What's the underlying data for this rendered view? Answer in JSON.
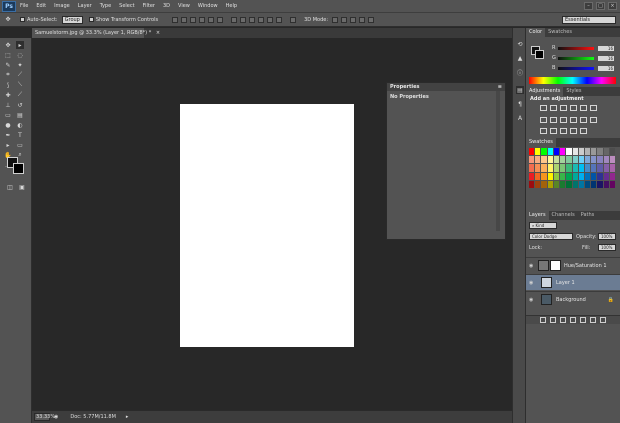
{
  "menubar": {
    "logo": "Ps",
    "items": [
      "File",
      "Edit",
      "Image",
      "Layer",
      "Type",
      "Select",
      "Filter",
      "3D",
      "View",
      "Window",
      "Help"
    ],
    "window_controls": [
      "–",
      "□",
      "×"
    ]
  },
  "options": {
    "auto_select_label": "Auto-Select:",
    "auto_select_value": "Group",
    "transform_controls_label": "Show Transform Controls",
    "mode_3d_label": "3D Mode:",
    "workspace": "Essentials"
  },
  "document": {
    "tab_title": "Samuelstorm.jpg @ 33.3% (Layer 1, RGB/8*) *",
    "tab_close": "×",
    "status_zoom": "33.33%",
    "status_doc": "Doc: 5.77M/11.8M"
  },
  "properties": {
    "title": "Properties",
    "content": "No Properties"
  },
  "color_panel": {
    "tabs": [
      "Color",
      "Swatches"
    ],
    "sliders": [
      {
        "letter": "R",
        "value": "16",
        "color": "#e03030"
      },
      {
        "letter": "G",
        "value": "16",
        "color": "#30c030"
      },
      {
        "letter": "B",
        "value": "16",
        "color": "#3060e0"
      }
    ]
  },
  "adjustments_panel": {
    "tabs": [
      "Adjustments",
      "Styles"
    ],
    "label": "Add an adjustment"
  },
  "swatches_panel": {
    "tabs": [
      "Swatches"
    ],
    "colors": [
      "#ff0000",
      "#ffff00",
      "#00ff00",
      "#00ffff",
      "#0000ff",
      "#ff00ff",
      "#ffffff",
      "#e6e6e6",
      "#cccccc",
      "#b3b3b3",
      "#999999",
      "#808080",
      "#666666",
      "#4d4d4d",
      "#f7977a",
      "#f9ad81",
      "#fdc68a",
      "#fff79a",
      "#c4df9b",
      "#a2d39c",
      "#82ca9d",
      "#7bcdc8",
      "#6ecff6",
      "#7ea7d8",
      "#8493ca",
      "#8882be",
      "#a187be",
      "#bc8dbf",
      "#f26c4f",
      "#f68e55",
      "#fbaf5c",
      "#fff467",
      "#acd372",
      "#7cc576",
      "#3bb878",
      "#1abbb4",
      "#00bff3",
      "#438cca",
      "#5574b9",
      "#605ca8",
      "#855fa8",
      "#a763a8",
      "#ed1c24",
      "#f26522",
      "#f7941d",
      "#fff200",
      "#8dc73f",
      "#39b54a",
      "#00a651",
      "#00a99d",
      "#00aeef",
      "#0072bc",
      "#0054a6",
      "#2e3192",
      "#662d91",
      "#92278f",
      "#9e0b0f",
      "#a0410d",
      "#a3620a",
      "#aba000",
      "#598527",
      "#1a7b30",
      "#007236",
      "#00746b",
      "#0076a3",
      "#004b80",
      "#003471",
      "#1b1464",
      "#440e62",
      "#630460"
    ]
  },
  "layers_panel": {
    "tabs": [
      "Layers",
      "Channels",
      "Paths"
    ],
    "kind": "Kind",
    "blend_mode": "Color Dodge",
    "opacity_label": "Opacity:",
    "opacity": "100%",
    "lock_label": "Lock:",
    "fill_label": "Fill:",
    "fill": "100%",
    "layers": [
      {
        "name": "Hue/Saturation 1"
      },
      {
        "name": "Layer 1"
      },
      {
        "name": "Background"
      }
    ]
  }
}
